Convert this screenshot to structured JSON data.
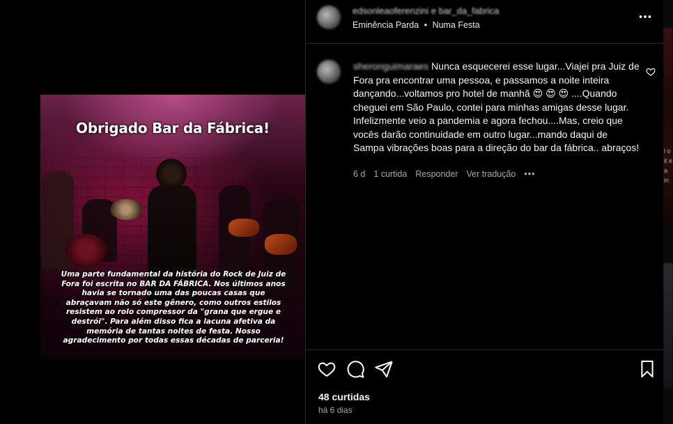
{
  "post_image": {
    "title": "Obrigado Bar da Fábrica!",
    "caption": "Uma parte fundamental da história do Rock de Juiz de Fora foi escrita no BAR DA FÁBRICA. Nos últimos anos havia se tornado uma das poucas casas que abraçavam não só este gênero, como outros estilos resistem ao rolo compressor da \"grana que ergue e destrói\". Para além disso fica a lacuna afetiva da memória de tantas noites de festa. Nosso agradecimento por todas essas décadas de parceria!"
  },
  "header": {
    "usernames": "edsonleaoferenzini e bar_da_fabrica",
    "audio_artist": "Eminência Parda",
    "audio_separator": "•",
    "audio_track": "Numa Festa",
    "more_icon": "more-horizontal-icon"
  },
  "comment": {
    "username": "sheronguimaraes",
    "text": "Nunca esquecerei esse lugar...Viajei pra Juiz de Fora pra encontrar uma pessoa, e passamos a noite inteira dançando...voltamos pro hotel de manhã 😍 😍 😍 ....Quando cheguei em São Paulo, contei para minhas amigas desse lugar. Infelizmente veio a pandemia e agora fechou....Mas, creio que vocês darão continuidade em outro lugar...mando daqui de Sampa vibrações boas para a direção do bar da fábrica.. abraços!",
    "time": "6 d",
    "likes": "1 curtida",
    "reply": "Responder",
    "translate": "Ver tradução",
    "options": "•••"
  },
  "actions": {
    "like_icon": "heart-icon",
    "comment_icon": "comment-icon",
    "share_icon": "send-icon",
    "save_icon": "bookmark-icon",
    "likes_count": "48 curtidas",
    "posted": "há 6 dias"
  },
  "next_post_strip": {
    "text_fragments": [
      "l o",
      "it e",
      "a",
      "in"
    ]
  }
}
